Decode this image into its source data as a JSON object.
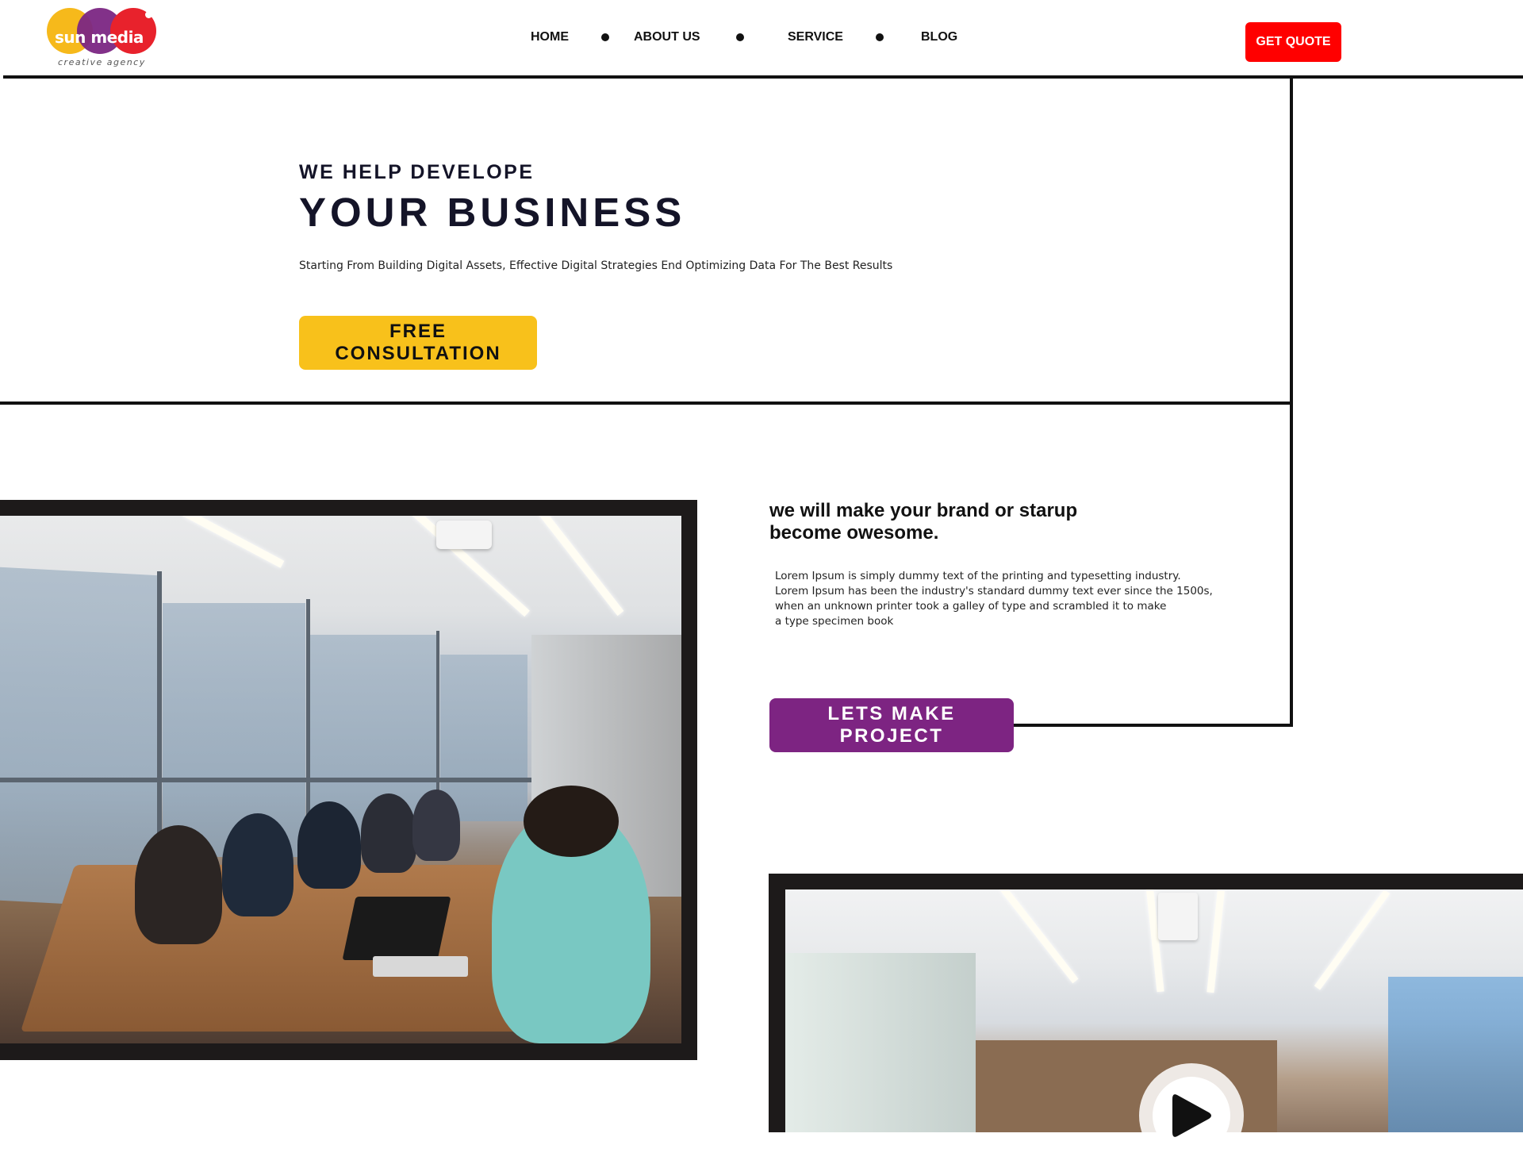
{
  "brand": {
    "name": "sun media",
    "tagline": "creative agency",
    "colors": {
      "yellow": "#f6b91b",
      "purple": "#7b2683",
      "red": "#e8222c"
    }
  },
  "nav": {
    "items": [
      {
        "label": "HOME"
      },
      {
        "label": "ABOUT US"
      },
      {
        "label": "SERVICE"
      },
      {
        "label": "BLOG"
      }
    ],
    "separator_icon": "bullet-dot-icon",
    "cta_label": "GET QUOTE",
    "cta_color": "#ff0000"
  },
  "hero": {
    "kicker": "WE HELP DEVELOPE",
    "title": "YOUR BUSINESS",
    "subtitle": "Starting From Building Digital Assets, Effective Digital Strategies End Optimizing Data For The Best Results",
    "cta_label": "FREE CONSULTATION",
    "cta_color": "#f8c11b"
  },
  "about": {
    "title_line1": "we will make your brand or starup",
    "title_line2": "become owesome.",
    "body_lines": [
      "Lorem Ipsum is simply dummy text of the printing and typesetting industry.",
      "Lorem Ipsum has been the industry's standard dummy text ever since the 1500s,",
      "when an unknown printer took a galley of type and scrambled it to make",
      "a type specimen book"
    ],
    "cta_label": "LETS MAKE PROJECT",
    "cta_color": "#7d2482"
  },
  "media": {
    "photo_1": "conference-room-meeting-photo",
    "photo_2": "conference-room-video-thumbnail",
    "play_icon": "play-icon"
  }
}
